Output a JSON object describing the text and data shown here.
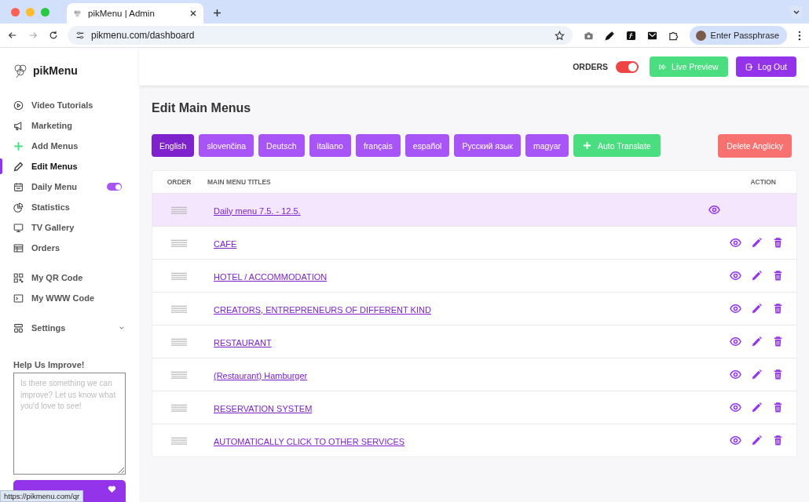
{
  "browser": {
    "tab_title": "pikMenu | Admin",
    "url": "pikmenu.com/dashboard",
    "profile": "Enter Passphrase"
  },
  "brand": "pikMenu",
  "header": {
    "orders_label": "ORDERS",
    "orders_on": true,
    "live_preview": "Live Preview",
    "logout": "Log Out"
  },
  "sidebar": {
    "groups": [
      [
        {
          "label": "Video Tutorials",
          "selected": false
        },
        {
          "label": "Marketing",
          "selected": false
        },
        {
          "label": "Add Menus",
          "selected": false
        },
        {
          "label": "Edit Menus",
          "selected": true
        },
        {
          "label": "Daily Menu",
          "selected": false,
          "toggle_on": true
        },
        {
          "label": "Statistics",
          "selected": false
        },
        {
          "label": "TV Gallery",
          "selected": false
        },
        {
          "label": "Orders",
          "selected": false
        }
      ],
      [
        {
          "label": "My QR Code",
          "selected": false
        },
        {
          "label": "My WWW Code",
          "selected": false
        }
      ],
      [
        {
          "label": "Settings",
          "selected": false,
          "expanded": false
        }
      ]
    ],
    "feedback": {
      "title": "Help Us Improve!",
      "placeholder": "Is there something we can improve? Let us know what you'd love to see!"
    }
  },
  "page_title": "Edit Main Menus",
  "languages": [
    {
      "label": "English",
      "selected": true
    },
    {
      "label": "slovenčina",
      "selected": false
    },
    {
      "label": "Deutsch",
      "selected": false
    },
    {
      "label": "italiano",
      "selected": false
    },
    {
      "label": "français",
      "selected": false
    },
    {
      "label": "español",
      "selected": false
    },
    {
      "label": "Русский язык",
      "selected": false
    },
    {
      "label": "magyar",
      "selected": false
    }
  ],
  "auto_translate": "Auto Translate",
  "delete_button": "Delete Anglicky",
  "table": {
    "columns": [
      "ORDER",
      "MAIN MENU TITLES",
      "ACTION"
    ],
    "rows": [
      {
        "title": "Daily menu 7.5. - 12.5.",
        "selected": true,
        "editable": false
      },
      {
        "title": "CAFE",
        "selected": false,
        "editable": true
      },
      {
        "title": "HOTEL / ACCOMMODATION",
        "selected": false,
        "editable": true
      },
      {
        "title": "CREATORS, ENTREPRENEURS OF DIFFERENT KIND",
        "selected": false,
        "editable": true
      },
      {
        "title": "RESTAURANT",
        "selected": false,
        "editable": true
      },
      {
        "title": "(Restaurant) Hamburger",
        "selected": false,
        "editable": true
      },
      {
        "title": "RESERVATION SYSTEM",
        "selected": false,
        "editable": true
      },
      {
        "title": "AUTOMATICALLY CLICK TO OTHER SERVICES",
        "selected": false,
        "editable": true
      }
    ]
  },
  "status_url": "https://pikmenu.com/qr"
}
